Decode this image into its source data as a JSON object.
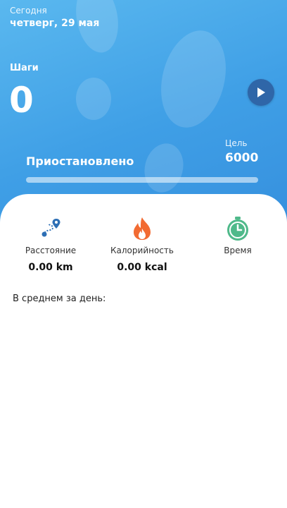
{
  "header": {
    "today_label": "Сегодня",
    "date": "четверг, 29 мая",
    "steps_label": "Шаги",
    "steps_value": "0",
    "goal_label": "Цель",
    "goal_value": "6000",
    "status": "Приостановлено",
    "progress_fraction": 0
  },
  "stats": [
    {
      "label": "Расстояние",
      "value": "0.00 km",
      "icon": "route-icon"
    },
    {
      "label": "Калорийность",
      "value": "0.00 kcal",
      "icon": "flame-icon"
    },
    {
      "label": "Время",
      "value": "",
      "icon": "stopwatch-icon"
    }
  ],
  "average_label": "В среднем за день:",
  "colors": {
    "hero": "#3f9fe6",
    "play_button": "#2f66a8",
    "route_icon": "#2d6fb5",
    "flame_icon": "#f26b32",
    "stopwatch_icon": "#4fb98a"
  }
}
